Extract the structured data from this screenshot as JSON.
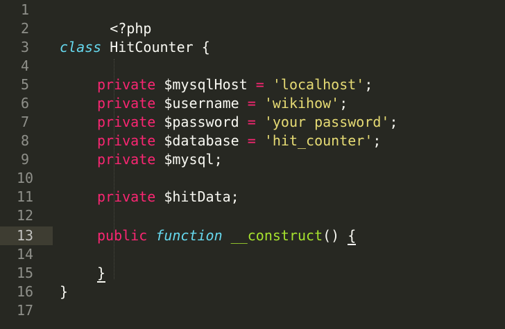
{
  "gutter": {
    "lines": [
      "1",
      "2",
      "3",
      "4",
      "5",
      "6",
      "7",
      "8",
      "9",
      "10",
      "11",
      "12",
      "13",
      "14",
      "15",
      "16",
      "17"
    ],
    "active_line": "13"
  },
  "code": {
    "line1": {
      "php_open": "<?php"
    },
    "line3": {
      "class_kw": "class",
      "class_name": " HitCounter ",
      "brace": "{"
    },
    "line5": {
      "kw": "private",
      "var": " $mysqlHost ",
      "op": "=",
      "str": "'localhost'",
      "end": ";"
    },
    "line6": {
      "kw": "private",
      "var": " $username ",
      "op": "=",
      "str": "'wikihow'",
      "end": ";"
    },
    "line7": {
      "kw": "private",
      "var": " $password ",
      "op": "=",
      "str": "'your password'",
      "end": ";"
    },
    "line8": {
      "kw": "private",
      "var": " $database ",
      "op": "=",
      "str": "'hit_counter'",
      "end": ";"
    },
    "line9": {
      "kw": "private",
      "var": " $mysql;"
    },
    "line11": {
      "kw": "private",
      "var": " $hitData;"
    },
    "line13": {
      "kw": "public",
      "func_kw": "function",
      "fn_name": "__construct",
      "parens": "()",
      "brace": "{"
    },
    "line15": {
      "brace": "}"
    },
    "line16": {
      "brace": "}"
    }
  },
  "colors": {
    "background": "#272822",
    "keyword": "#f92672",
    "string": "#e6db74",
    "storage": "#66d9ef",
    "function": "#a6e22e",
    "text": "#f8f8f2",
    "gutter_text": "#8f908a",
    "active_line": "#3e3d32"
  }
}
